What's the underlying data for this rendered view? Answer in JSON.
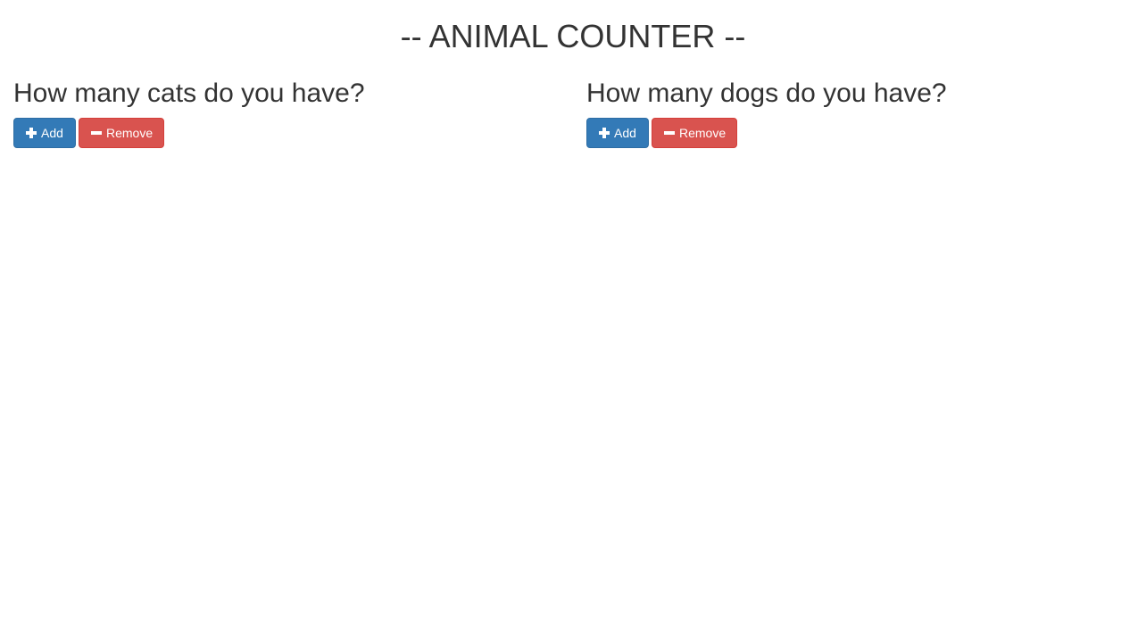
{
  "header": {
    "title": "-- ANIMAL COUNTER --"
  },
  "cats": {
    "question": "How many cats do you have?",
    "add_label": "Add",
    "remove_label": "Remove"
  },
  "dogs": {
    "question": "How many dogs do you have?",
    "add_label": "Add",
    "remove_label": "Remove"
  },
  "icons": {
    "add": "plus-icon",
    "remove": "minus-icon"
  },
  "colors": {
    "text": "#333333",
    "add_button": "#337ab7",
    "remove_button": "#d9534f"
  }
}
